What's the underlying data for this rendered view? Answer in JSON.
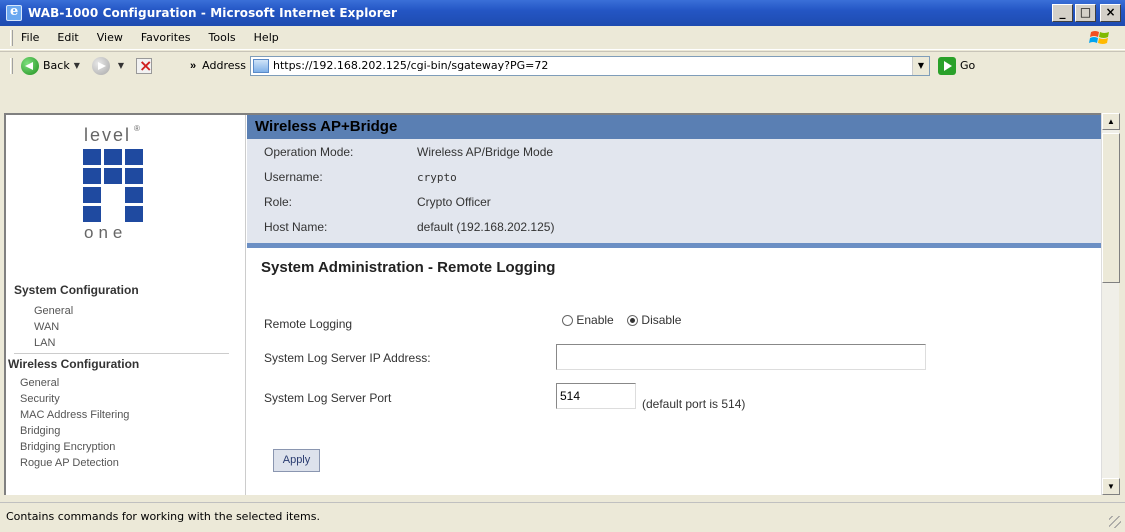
{
  "window": {
    "title": "WAB-1000 Configuration - Microsoft Internet Explorer",
    "min": "_",
    "max": "□",
    "close": "×"
  },
  "menu": {
    "file": "File",
    "edit": "Edit",
    "view": "View",
    "favorites": "Favorites",
    "tools": "Tools",
    "help": "Help"
  },
  "toolbar": {
    "back_label": "Back",
    "chevron": "»",
    "address_label": "Address",
    "url": "https://192.168.202.125/cgi-bin/sgateway?PG=72",
    "go_label": "Go"
  },
  "logo": {
    "top_text": "level",
    "bottom_text": "one",
    "mark": "®"
  },
  "nav": {
    "system_configuration": "System Configuration",
    "system_items": [
      "General",
      "WAN",
      "LAN"
    ],
    "wireless_configuration": "Wireless Configuration",
    "wireless_items": [
      "General",
      "Security",
      "MAC Address Filtering",
      "Bridging",
      "Bridging Encryption",
      "Rogue AP Detection"
    ]
  },
  "header": {
    "title": "Wireless AP+Bridge"
  },
  "info": {
    "operation_mode_label": "Operation Mode:",
    "operation_mode_value": "Wireless AP/Bridge Mode",
    "username_label": "Username:",
    "username_value": "crypto",
    "role_label": "Role:",
    "role_value": "Crypto Officer",
    "host_label": "Host Name:",
    "host_value": "default (192.168.202.125)"
  },
  "form": {
    "section_title": "System Administration - Remote Logging",
    "remote_logging_label": "Remote Logging",
    "enable_label": "Enable",
    "disable_label": "Disable",
    "selected": "Disable",
    "server_ip_label": "System Log Server IP Address:",
    "server_ip_value": "",
    "server_port_label": "System Log Server Port",
    "server_port_value": "514",
    "port_hint": "(default port is 514)",
    "apply_label": "Apply"
  },
  "status": {
    "text": "Contains commands for working with the selected items."
  }
}
